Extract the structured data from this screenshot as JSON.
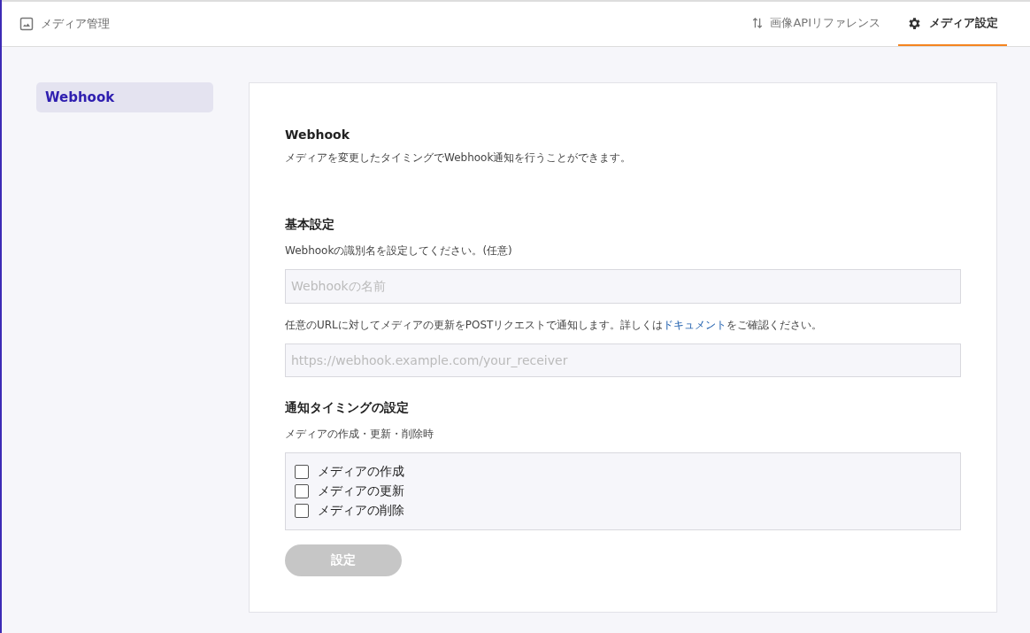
{
  "header": {
    "title": "メディア管理",
    "tabs": [
      {
        "label": "画像APIリファレンス",
        "kind": "reference",
        "selected": false
      },
      {
        "label": "メディア設定",
        "kind": "settings",
        "selected": true
      }
    ]
  },
  "sidebar": {
    "items": [
      {
        "label": "Webhook",
        "selected": true
      }
    ]
  },
  "panel": {
    "title": "Webhook",
    "description": "メディアを変更したタイミングでWebhook通知を行うことができます。",
    "basic": {
      "title": "基本設定",
      "name_hint": "Webhookの識別名を設定してください。(任意)",
      "name_field": {
        "placeholder": "Webhookの名前"
      },
      "url_hint": {
        "before": "任意のURLに対してメディアの更新をPOSTリクエストで通知します。詳しくは",
        "link": "ドキュメント",
        "after": "をご確認ください。"
      },
      "url_field": {
        "placeholder": "https://webhook.example.com/your_receiver"
      }
    },
    "timing": {
      "title": "通知タイミングの設定",
      "subtitle": "メディアの作成・更新・削除時",
      "options": [
        {
          "label": "メディアの作成",
          "checked": false
        },
        {
          "label": "メディアの更新",
          "checked": false
        },
        {
          "label": "メディアの削除",
          "checked": false
        }
      ]
    },
    "submit": {
      "label": "設定",
      "disabled": true
    }
  }
}
